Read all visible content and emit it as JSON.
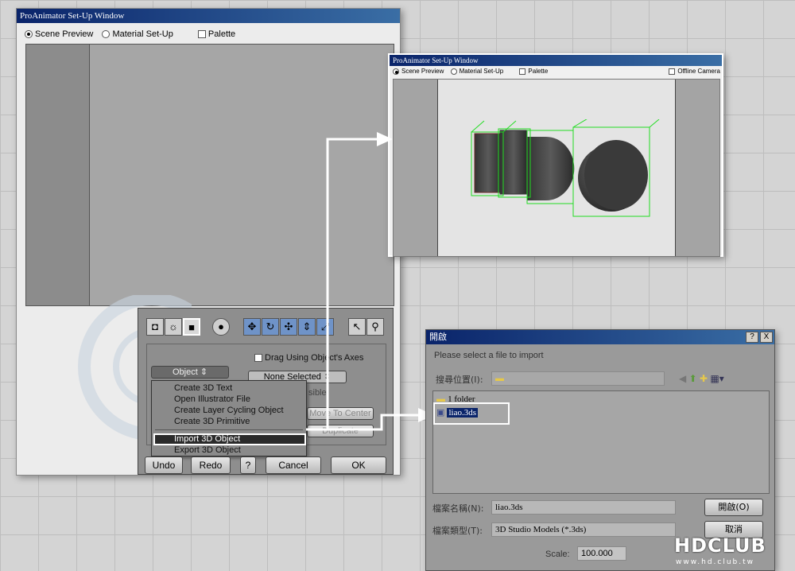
{
  "main_window": {
    "title": "ProAnimator Set-Up Window",
    "radio_scene": "Scene Preview",
    "radio_material": "Material Set-Up",
    "check_palette": "Palette",
    "panel": {
      "drag_axes": "Drag Using Object's Axes",
      "object_select": "Object",
      "none_selected": "None Selected",
      "visible_partial": "sible",
      "move_center": "Move To Center",
      "duplicate": "Duplicate",
      "menu": [
        "Create 3D Text",
        "Open Illustrator File",
        "Create Layer Cycling Object",
        "Create 3D Primitive",
        "Import 3D Object",
        "Export 3D Object"
      ],
      "undo": "Undo",
      "redo": "Redo",
      "help": "?",
      "cancel": "Cancel",
      "ok": "OK"
    }
  },
  "preview_window": {
    "title": "ProAnimator Set-Up Window",
    "radio_scene": "Scene Preview",
    "radio_material": "Material Set-Up",
    "check_palette": "Palette",
    "check_camera": "Offline Camera"
  },
  "open_dialog": {
    "title": "開啟",
    "help_btn": "?",
    "close_btn": "X",
    "hint": "Please select a file to import",
    "lookin_label": "搜尋位置(I):",
    "lookin_value": "",
    "files": [
      {
        "name": "1 folder",
        "icon": "folder-icon"
      },
      {
        "name": "liao.3ds",
        "icon": "3ds-file-icon"
      }
    ],
    "filename_label": "檔案名稱(N):",
    "filename_value": "liao.3ds",
    "filetype_label": "檔案類型(T):",
    "filetype_value": "3D Studio Models (*.3ds)",
    "open_btn": "開啟(O)",
    "cancel_btn": "取消",
    "scale_label": "Scale:",
    "scale_value": "100.000"
  },
  "watermark": {
    "logo": "HDCLUB",
    "url": "www.hd.club.tw"
  },
  "colors": {
    "titlebar": "#0a246a",
    "wireframe": "#22dd22",
    "highlight_box": "#ffffff"
  }
}
